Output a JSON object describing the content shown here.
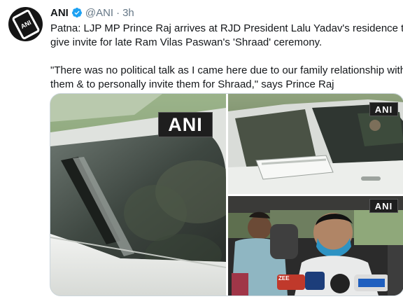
{
  "tweet": {
    "author_name": "ANI",
    "handle": "@ANI",
    "separator": "·",
    "time": "3h",
    "avatar_text": "ANI",
    "text_lines": [
      "Patna: LJP MP Prince Raj arrives at RJD President Lalu Yadav's residence to",
      "give invite for late Ram Vilas Paswan's 'Shraad' ceremony."
    ],
    "quote_lines": [
      "\"There was no political talk as I came here due to our family relationship with",
      "them & to personally invite them for Shraad,\" says Prince Raj"
    ]
  },
  "media": {
    "watermark_left": "ANI",
    "watermark_top_right": "ANI",
    "watermark_bottom_right": "ANI",
    "mic_label": "ZEE"
  },
  "colors": {
    "verified_blue": "#1da1f2",
    "text": "#14171a",
    "muted": "#657786",
    "border": "#ccd6dd"
  }
}
